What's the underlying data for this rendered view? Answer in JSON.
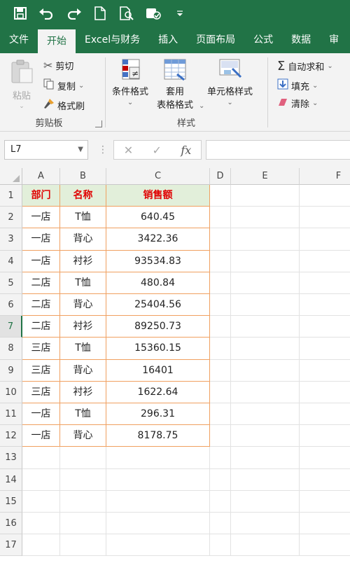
{
  "quick_access": {
    "icons": [
      "save-icon",
      "undo-icon",
      "redo-icon",
      "new-file-icon",
      "print-preview-icon",
      "sync-icon",
      "customize-icon"
    ]
  },
  "tabs": [
    {
      "label": "文件",
      "active": false
    },
    {
      "label": "开始",
      "active": true
    },
    {
      "label": "Excel与财务",
      "active": false
    },
    {
      "label": "插入",
      "active": false
    },
    {
      "label": "页面布局",
      "active": false
    },
    {
      "label": "公式",
      "active": false
    },
    {
      "label": "数据",
      "active": false
    },
    {
      "label": "审",
      "active": false
    }
  ],
  "ribbon": {
    "clipboard": {
      "paste": "粘贴",
      "cut": "剪切",
      "copy": "复制",
      "format_painter": "格式刷",
      "label": "剪贴板"
    },
    "styles": {
      "conditional": "条件格式",
      "table_format_1": "套用",
      "table_format_2": "表格格式",
      "cell_styles": "单元格样式",
      "label": "样式"
    },
    "editing": {
      "autosum": "自动求和",
      "fill": "填充",
      "clear": "清除"
    }
  },
  "formula_bar": {
    "name_box": "L7",
    "cancel_symbol": "✕",
    "enter_symbol": "✓",
    "fx_symbol": "fx",
    "value": ""
  },
  "grid": {
    "columns": [
      "A",
      "B",
      "C",
      "D",
      "E",
      "F"
    ],
    "rows": [
      "1",
      "2",
      "3",
      "4",
      "5",
      "6",
      "7",
      "8",
      "9",
      "10",
      "11",
      "12",
      "13",
      "14",
      "15",
      "16",
      "17"
    ],
    "selected_row": "7",
    "header": [
      "部门",
      "名称",
      "销售额"
    ],
    "data": [
      [
        "一店",
        "T恤",
        "640.45"
      ],
      [
        "一店",
        "背心",
        "3422.36"
      ],
      [
        "一店",
        "衬衫",
        "93534.83"
      ],
      [
        "二店",
        "T恤",
        "480.84"
      ],
      [
        "二店",
        "背心",
        "25404.56"
      ],
      [
        "二店",
        "衬衫",
        "89250.73"
      ],
      [
        "三店",
        "T恤",
        "15360.15"
      ],
      [
        "三店",
        "背心",
        "16401"
      ],
      [
        "三店",
        "衬衫",
        "1622.64"
      ],
      [
        "一店",
        "T恤",
        "296.31"
      ],
      [
        "一店",
        "背心",
        "8178.75"
      ]
    ]
  }
}
